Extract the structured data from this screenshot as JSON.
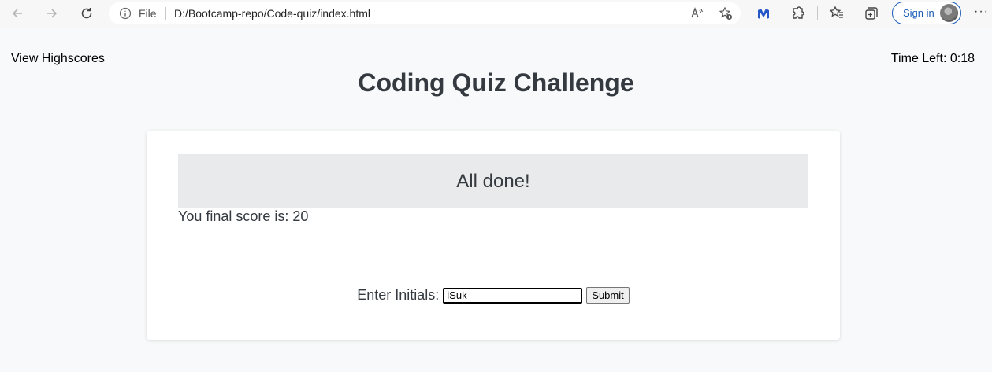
{
  "browser": {
    "back_icon": "arrow-left-icon",
    "forward_icon": "arrow-right-icon",
    "refresh_icon": "refresh-icon",
    "address_scheme": "File",
    "address_url": "D:/Bootcamp-repo/Code-quiz/index.html",
    "signin_label": "Sign in",
    "more_label": "···"
  },
  "page": {
    "view_highscores": "View Highscores",
    "time_left": "Time Left: 0:18",
    "title": "Coding Quiz Challenge"
  },
  "result": {
    "heading": "All done!",
    "final_score": "You final score is: 20",
    "initials_label": "Enter Initials:",
    "initials_value": "iSuk",
    "submit_label": "Submit"
  },
  "colors": {
    "title_text": "#343a40",
    "page_background": "#f8f9fa",
    "banner_background": "#e9eaeb",
    "signin_accent": "#1a5bb5"
  }
}
